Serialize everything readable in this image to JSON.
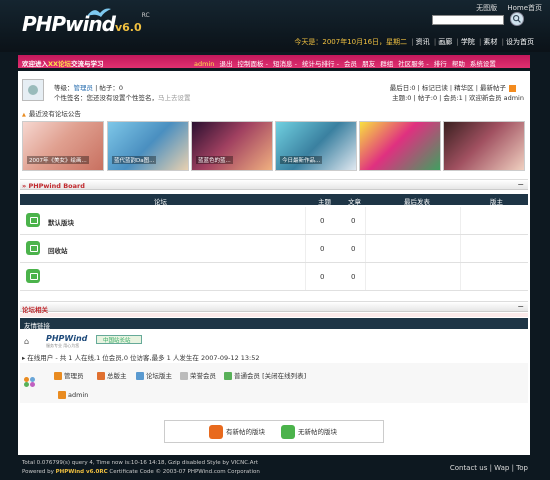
{
  "header": {
    "logo_text": "PHPwind",
    "logo_version": "v6.0",
    "logo_rc": "RC",
    "top_links": [
      "无图版",
      "Home首页"
    ],
    "date_text": "今天是：2007年10月16日，星期二",
    "nav_links": [
      "资讯",
      "画廊",
      "学院",
      "素材",
      "设为首页"
    ]
  },
  "navbar": {
    "welcome_prefix": "欢迎进入",
    "welcome_highlight": "XX论坛",
    "welcome_suffix": "交流与学习",
    "admin": "admin",
    "items": [
      "退出",
      "控制面板 -",
      "短消息 -",
      "统计与排行 -",
      "会员",
      "朋友",
      "群组",
      "社区服务 -",
      "排行",
      "帮助",
      "系统设置"
    ]
  },
  "user": {
    "level_label": "等级：",
    "level_value": "管理员",
    "posts_label": "帖子：0",
    "signature_text": "个性签名：您还没有设置个性签名，",
    "signature_link": "马上去设置",
    "stat_line1": "最后日:0 | 标记已读 | 精华区 | 最新帖子",
    "stat_line2": "主题:0 | 帖子:0 | 会员:1 | 欢迎新会员 admin"
  },
  "notice": "最近没有论坛公告",
  "thumbs": [
    {
      "caption": "2007年《美女》绘画..."
    },
    {
      "caption": "蓝代蓝韵Da图..."
    },
    {
      "caption": "蓝蓝色的蓝..."
    },
    {
      "caption": "今日最新作品..."
    },
    {
      "caption": ""
    },
    {
      "caption": ""
    }
  ],
  "board": {
    "title": "» PHPwind Board",
    "collapse": "−",
    "columns": [
      "论坛",
      "主题",
      "文章",
      "最后发表",
      "版主"
    ],
    "rows": [
      {
        "name": "默认版块",
        "topics": "0",
        "posts": "0"
      },
      {
        "name": "回收站",
        "topics": "0",
        "posts": "0"
      },
      {
        "name": "",
        "topics": "0",
        "posts": "0"
      }
    ]
  },
  "related": {
    "title": "论坛相关",
    "collapse": "−",
    "links_title": "友情链接",
    "pw_logo": "PHPWind",
    "pw_sub": "服务专业 用心为您",
    "cn_logo": "中国站长站",
    "online_text": "在线用户 - 共 1 人在线,1 位会员,0 位访客,最多 1 人发生在 2007-09-12 13:52",
    "legend": [
      "管理员",
      "总版主",
      "论坛版主",
      "荣誉会员",
      "普通会员 [关闭在线列表]"
    ],
    "online_user": "admin"
  },
  "status_legend": {
    "has_new": "有新帖的版块",
    "no_new": "无新帖的版块"
  },
  "footer": {
    "line1": "Total 0.076799(s) query 4, Time now is:10-16 14:18, Gzip disabled    Style by VICNC.Art",
    "line2_prefix": "Powered by",
    "line2_brand": "PHPWind v6.0RC",
    "line2_suffix": "Certificate Code © 2003-07 PHPWind.com Corporation",
    "links": "Contact us | Wap | Top"
  },
  "colors": {
    "navbar": "#d02060",
    "header_bg": "#101c24",
    "table_header": "#1e3546",
    "accent_red": "#c0282d"
  }
}
